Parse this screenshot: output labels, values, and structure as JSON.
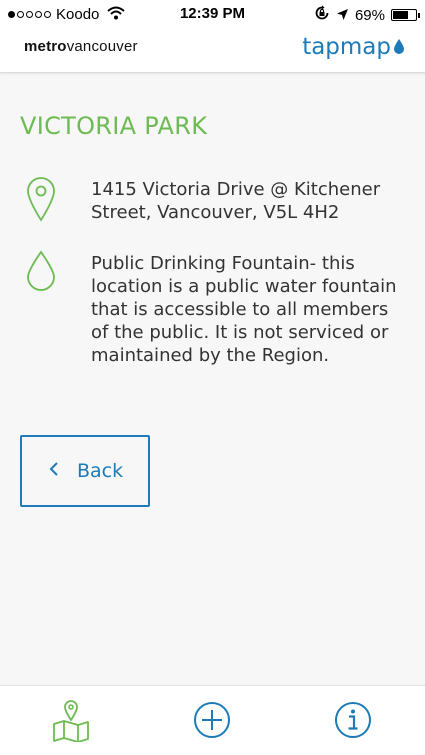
{
  "status_bar": {
    "carrier": "Koodo",
    "signal_bars_filled": 1,
    "signal_bars_total": 5,
    "time": "12:39 PM",
    "battery_percent": "69%",
    "battery_level": 0.69,
    "icons": [
      "wifi-icon",
      "rotation-lock-icon",
      "location-arrow-icon",
      "battery-icon"
    ]
  },
  "header": {
    "brand_bold": "metro",
    "brand_regular": "vancouver",
    "app_name": "tapmap",
    "app_icon": "water-drop-icon"
  },
  "detail": {
    "title": "VICTORIA PARK",
    "address_icon": "map-pin-icon",
    "address": "1415 Victoria Drive @ Kitchener Street, Vancouver, V5L 4H2",
    "description_icon": "water-drop-outline-icon",
    "description": "Public Drinking Fountain- this location is a public water fountain that is accessible to all members of the public. It is not serviced or maintained by the Region."
  },
  "back_button": {
    "label": "Back",
    "icon": "chevron-left-icon"
  },
  "tab_bar": {
    "items": [
      {
        "icon": "map-pin-icon-map"
      },
      {
        "icon": "plus-circle-icon"
      },
      {
        "icon": "info-circle-icon"
      }
    ]
  },
  "colors": {
    "accent_green": "#6dbb52",
    "accent_blue": "#1c7bb8",
    "background": "#f7f7f7"
  }
}
